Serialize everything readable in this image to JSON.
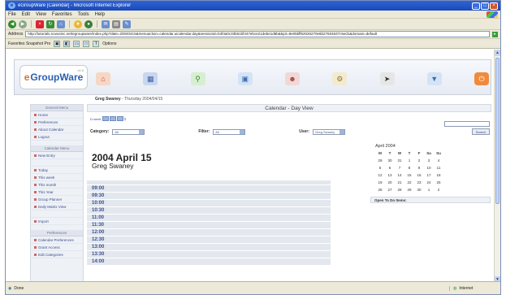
{
  "window": {
    "title": "eGroupWare [Calendar] - Microsoft Internet Explorer",
    "buttons": [
      "_",
      "□",
      "×"
    ]
  },
  "menu": [
    "File",
    "Edit",
    "View",
    "Favorites",
    "Tools",
    "Help"
  ],
  "address": {
    "label": "Address",
    "url": "http://tutorials.novusinc.net/egroupware/index.php?date=20040415&menuaction=calendar.uicalendar.day&sessionid=b4f4a0c33b61bf447ebce21debe1d6b&kp3=8e05bff62026270e6b27604637c5ed1&domain=default"
  },
  "links": {
    "label": "Favorites Snapshot Pro",
    "options": "Options"
  },
  "status": {
    "left": "Done",
    "zone": "Internet"
  },
  "app": {
    "logo": "GroupWare",
    "logo_prefix": "e",
    "version": "v1.0",
    "user_name": "Greg Swaney",
    "user_date": " - Thursday 2004/04/15"
  },
  "sidebar": {
    "sections": [
      {
        "title": "General Menu",
        "items": [
          "Home",
          "Preferences",
          "About Calendar",
          "Logout"
        ]
      },
      {
        "title": "Calendar Menu",
        "items": [
          "New Entry",
          "",
          "Today",
          "This week",
          "This month",
          "This Year",
          "Group Planner",
          "Daily Matrix View",
          "",
          "Import"
        ]
      },
      {
        "title": "Preferences",
        "items": [
          "Calendar Preferences",
          "Grant Access",
          "Edit Categories"
        ]
      }
    ]
  },
  "main": {
    "view_title": "Calendar - Day View",
    "view_buttons_label": "D-week",
    "filters": [
      {
        "label": "Category:",
        "value": "All"
      },
      {
        "label": "Filter:",
        "value": "All"
      },
      {
        "label": "User:",
        "value": "Greg Swaney"
      }
    ],
    "search_button": "Search",
    "date_heading": "2004 April 15",
    "person_heading": "Greg Swaney",
    "time_slots": [
      "09:00",
      "09:30",
      "10:00",
      "10:30",
      "11:00",
      "11:30",
      "12:00",
      "12:30",
      "13:00",
      "13:30",
      "14:00"
    ],
    "todo_title": "Open To Do Items:"
  },
  "minical": {
    "title": "April 2004",
    "headers": [
      "M",
      "T",
      "W",
      "T",
      "F",
      "Sa",
      "Su"
    ],
    "weeks": [
      [
        "29",
        "30",
        "31",
        "1",
        "2",
        "3",
        "4"
      ],
      [
        "5",
        "6",
        "7",
        "8",
        "9",
        "10",
        "11"
      ],
      [
        "12",
        "13",
        "14",
        "15",
        "16",
        "17",
        "18"
      ],
      [
        "19",
        "20",
        "21",
        "22",
        "23",
        "24",
        "25"
      ],
      [
        "26",
        "27",
        "28",
        "29",
        "30",
        "1",
        "2"
      ]
    ]
  }
}
